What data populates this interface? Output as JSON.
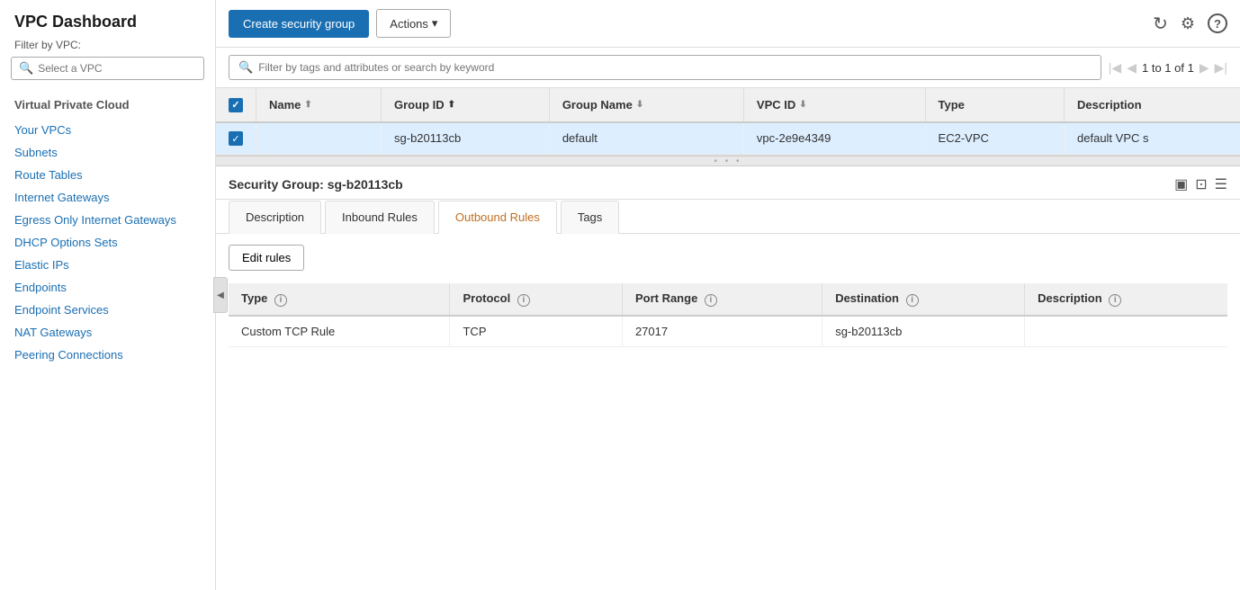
{
  "sidebar": {
    "title": "VPC Dashboard",
    "filter_label": "Filter by VPC:",
    "search_placeholder": "Select a VPC",
    "section_title": "Virtual Private Cloud",
    "items": [
      {
        "id": "your-vpcs",
        "label": "Your VPCs"
      },
      {
        "id": "subnets",
        "label": "Subnets"
      },
      {
        "id": "route-tables",
        "label": "Route Tables"
      },
      {
        "id": "internet-gateways",
        "label": "Internet Gateways"
      },
      {
        "id": "egress-only",
        "label": "Egress Only Internet Gateways"
      },
      {
        "id": "dhcp-options",
        "label": "DHCP Options Sets"
      },
      {
        "id": "elastic-ips",
        "label": "Elastic IPs"
      },
      {
        "id": "endpoints",
        "label": "Endpoints"
      },
      {
        "id": "endpoint-services",
        "label": "Endpoint Services"
      },
      {
        "id": "nat-gateways",
        "label": "NAT Gateways"
      },
      {
        "id": "peering-connections",
        "label": "Peering Connections"
      }
    ]
  },
  "toolbar": {
    "create_label": "Create security group",
    "actions_label": "Actions",
    "chevron": "▾",
    "icons": {
      "refresh": "↻",
      "settings": "⚙",
      "help": "?"
    }
  },
  "filter": {
    "placeholder": "Filter by tags and attributes or search by keyword",
    "pagination": "1 to 1 of 1"
  },
  "table": {
    "columns": [
      {
        "id": "checkbox",
        "label": ""
      },
      {
        "id": "name",
        "label": "Name",
        "sorted": "asc"
      },
      {
        "id": "group-id",
        "label": "Group ID",
        "sorted": "asc"
      },
      {
        "id": "group-name",
        "label": "Group Name",
        "sorted": "none"
      },
      {
        "id": "vpc-id",
        "label": "VPC ID",
        "sorted": "none"
      },
      {
        "id": "type",
        "label": "Type"
      },
      {
        "id": "description",
        "label": "Description"
      }
    ],
    "rows": [
      {
        "checkbox": true,
        "name": "",
        "group_id": "sg-b20113cb",
        "group_name": "default",
        "vpc_id": "vpc-2e9e4349",
        "type": "EC2-VPC",
        "description": "default VPC s"
      }
    ]
  },
  "detail": {
    "label": "Security Group:",
    "group_id": "sg-b20113cb",
    "tabs": [
      {
        "id": "description",
        "label": "Description"
      },
      {
        "id": "inbound-rules",
        "label": "Inbound Rules"
      },
      {
        "id": "outbound-rules",
        "label": "Outbound Rules",
        "active": true
      },
      {
        "id": "tags",
        "label": "Tags"
      }
    ],
    "edit_rules_label": "Edit rules",
    "rules_table": {
      "columns": [
        {
          "id": "type",
          "label": "Type"
        },
        {
          "id": "protocol",
          "label": "Protocol"
        },
        {
          "id": "port-range",
          "label": "Port Range"
        },
        {
          "id": "destination",
          "label": "Destination"
        },
        {
          "id": "description",
          "label": "Description"
        }
      ],
      "rows": [
        {
          "type": "Custom TCP Rule",
          "protocol": "TCP",
          "port_range": "27017",
          "destination": "sg-b20113cb",
          "description": ""
        }
      ]
    },
    "actions_icons": [
      "▣",
      "⊡",
      "☰"
    ]
  }
}
